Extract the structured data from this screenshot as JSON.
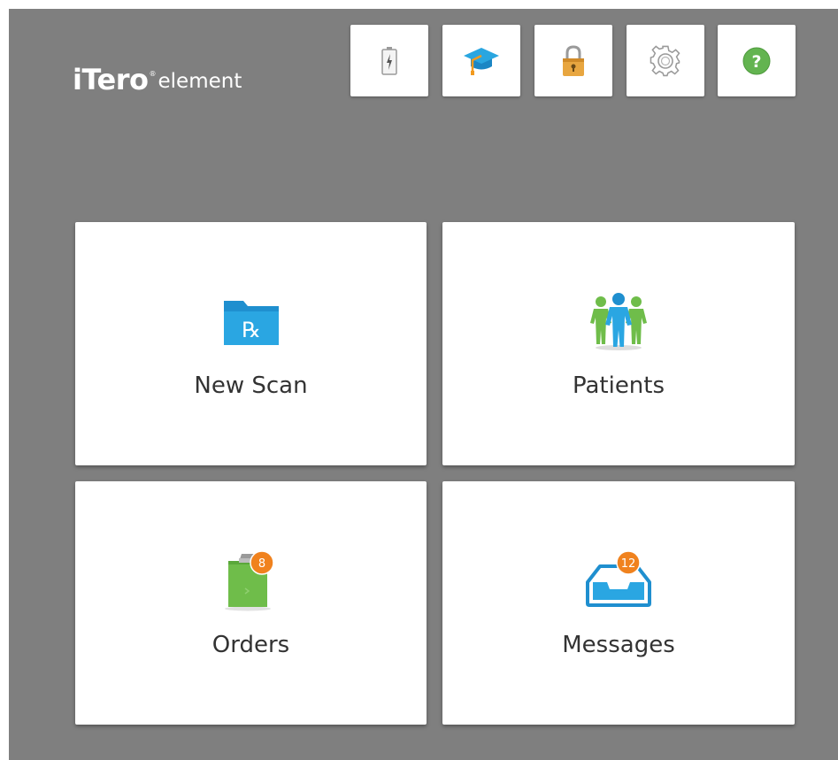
{
  "header": {
    "logo_brand": "iTero",
    "logo_registered": "®",
    "logo_sub": "element"
  },
  "toolbar": {
    "buttons": [
      {
        "name": "battery-button",
        "icon": "battery-icon"
      },
      {
        "name": "training-button",
        "icon": "graduation-cap-icon"
      },
      {
        "name": "lock-button",
        "icon": "lock-icon"
      },
      {
        "name": "settings-button",
        "icon": "gear-icon"
      },
      {
        "name": "help-button",
        "icon": "help-icon",
        "glyph": "?"
      }
    ]
  },
  "tiles": {
    "new_scan": {
      "label": "New Scan",
      "icon": "rx-folder-icon",
      "glyph": "℞"
    },
    "patients": {
      "label": "Patients",
      "icon": "patients-icon"
    },
    "orders": {
      "label": "Orders",
      "icon": "orders-clipboard-icon",
      "badge": "8"
    },
    "messages": {
      "label": "Messages",
      "icon": "inbox-tray-icon",
      "badge": "12"
    }
  },
  "colors": {
    "background": "#7f7f7f",
    "accent_blue": "#1f9ad6",
    "badge_orange": "#f0821e",
    "orders_green": "#6fbd4a",
    "help_green": "#63b450"
  }
}
